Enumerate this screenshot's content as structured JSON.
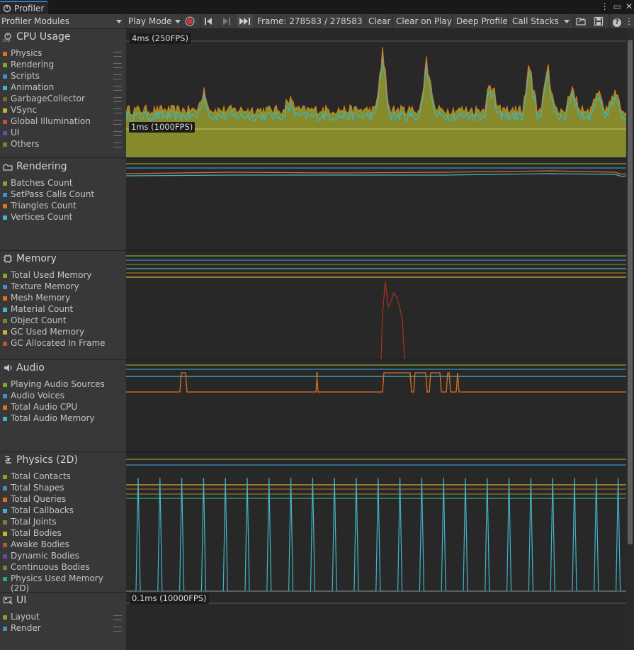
{
  "window": {
    "tab_title": "Profiler",
    "controls": [
      "⋮",
      "▭",
      "✕"
    ]
  },
  "toolbar": {
    "modules_dropdown": "Profiler Modules",
    "play_mode": "Play Mode",
    "frame_label": "Frame: 278583 / 278583",
    "clear": "Clear",
    "clear_on_play": "Clear on Play",
    "deep_profile": "Deep Profile",
    "call_stacks": "Call Stacks",
    "help_icon": "?"
  },
  "modules": [
    {
      "name": "CPU Usage",
      "icon": "cpu-icon",
      "items": [
        {
          "label": "Physics",
          "color": "#e07020"
        },
        {
          "label": "Rendering",
          "color": "#85a32c"
        },
        {
          "label": "Scripts",
          "color": "#3c8fc8"
        },
        {
          "label": "Animation",
          "color": "#42b4c6"
        },
        {
          "label": "GarbageCollector",
          "color": "#7a6a2c"
        },
        {
          "label": "VSync",
          "color": "#c4b42a"
        },
        {
          "label": "Global Illumination",
          "color": "#b8543c"
        },
        {
          "label": "UI",
          "color": "#6a4aa8"
        },
        {
          "label": "Others",
          "color": "#7a8232"
        }
      ],
      "chart_labels": [
        "4ms (250FPS)",
        "1ms (1000FPS)"
      ]
    },
    {
      "name": "Rendering",
      "icon": "rendering-icon",
      "items": [
        {
          "label": "Batches Count",
          "color": "#85a32c"
        },
        {
          "label": "SetPass Calls Count",
          "color": "#3c8fc8"
        },
        {
          "label": "Triangles Count",
          "color": "#e07020"
        },
        {
          "label": "Vertices Count",
          "color": "#42b4c6"
        }
      ]
    },
    {
      "name": "Memory",
      "icon": "memory-icon",
      "items": [
        {
          "label": "Total Used Memory",
          "color": "#85a32c"
        },
        {
          "label": "Texture Memory",
          "color": "#3c8fc8"
        },
        {
          "label": "Mesh Memory",
          "color": "#e07020"
        },
        {
          "label": "Material Count",
          "color": "#42b4c6"
        },
        {
          "label": "Object Count",
          "color": "#7a8232"
        },
        {
          "label": "GC Used Memory",
          "color": "#c4b42a"
        },
        {
          "label": "GC Allocated In Frame",
          "color": "#b8543c"
        }
      ]
    },
    {
      "name": "Audio",
      "icon": "audio-icon",
      "items": [
        {
          "label": "Playing Audio Sources",
          "color": "#85a32c"
        },
        {
          "label": "Audio Voices",
          "color": "#3c8fc8"
        },
        {
          "label": "Total Audio CPU",
          "color": "#e07020"
        },
        {
          "label": "Total Audio Memory",
          "color": "#42b4c6"
        }
      ]
    },
    {
      "name": "Physics (2D)",
      "icon": "physics2d-icon",
      "items": [
        {
          "label": "Total Contacts",
          "color": "#85a32c"
        },
        {
          "label": "Total Shapes",
          "color": "#3c8fc8"
        },
        {
          "label": "Total Queries",
          "color": "#e07020"
        },
        {
          "label": "Total Callbacks",
          "color": "#42b4c6"
        },
        {
          "label": "Total Joints",
          "color": "#7a8232"
        },
        {
          "label": "Total Bodies",
          "color": "#c4b42a"
        },
        {
          "label": "Awake Bodies",
          "color": "#b8543c"
        },
        {
          "label": "Dynamic Bodies",
          "color": "#6a4aa8"
        },
        {
          "label": "Continuous Bodies",
          "color": "#7a8232"
        },
        {
          "label": "Physics Used Memory (2D)",
          "color": "#2ca86a"
        }
      ]
    },
    {
      "name": "UI",
      "icon": "ui-icon",
      "items": [
        {
          "label": "Layout",
          "color": "#85a32c"
        },
        {
          "label": "Render",
          "color": "#3c8fc8"
        }
      ],
      "chart_labels": [
        "0.1ms (10000FPS)"
      ]
    }
  ]
}
